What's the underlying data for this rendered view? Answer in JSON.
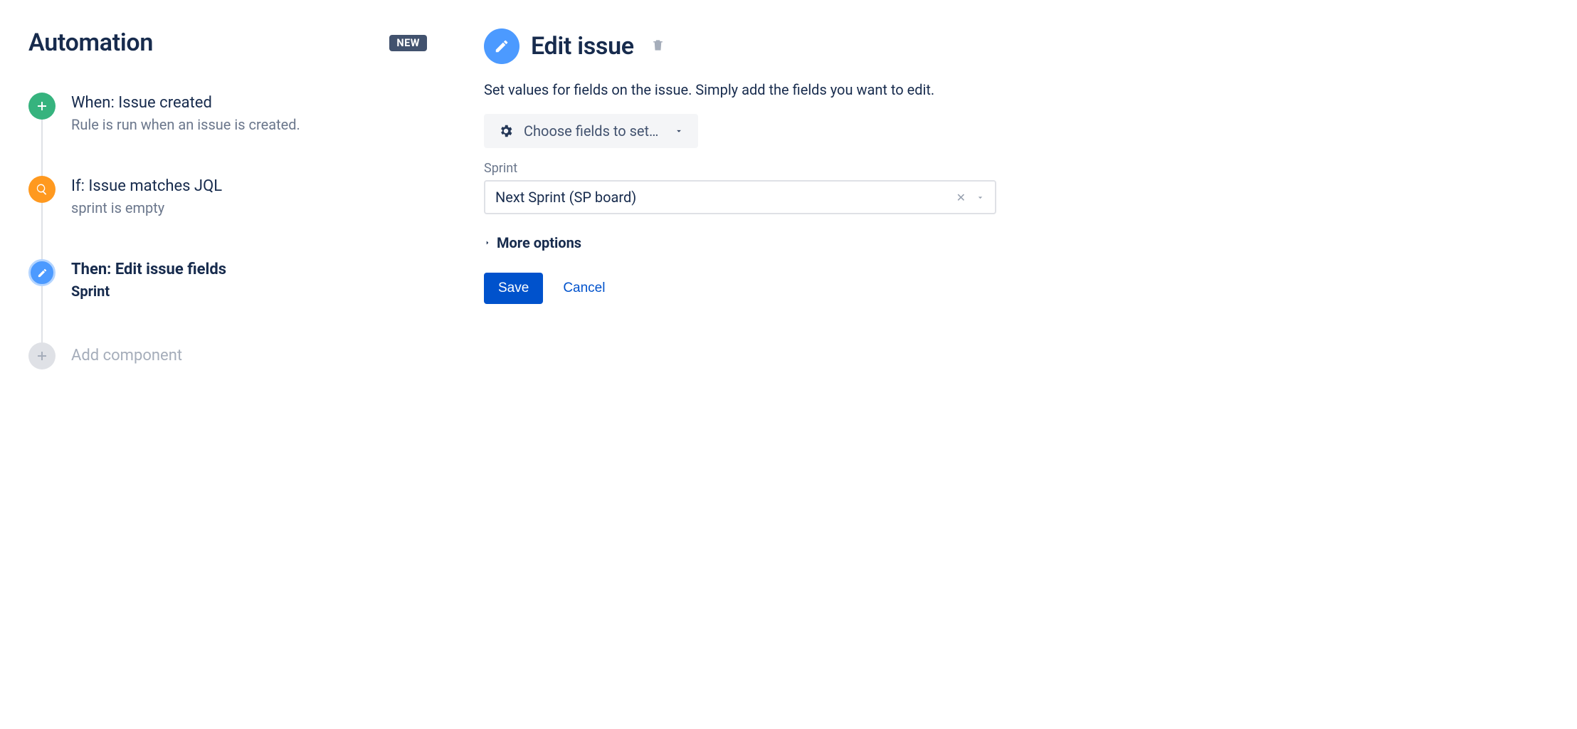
{
  "header": {
    "title": "Automation",
    "badge": "NEW"
  },
  "steps": {
    "trigger": {
      "title": "When: Issue created",
      "desc": "Rule is run when an issue is created."
    },
    "condition": {
      "title": "If: Issue matches JQL",
      "desc": "sprint is empty"
    },
    "action": {
      "title": "Then: Edit issue fields",
      "sub": "Sprint"
    },
    "add": "Add component"
  },
  "panel": {
    "title": "Edit issue",
    "desc": "Set values for fields on the issue. Simply add the fields you want to edit.",
    "chooser_label": "Choose fields to set…",
    "field_label": "Sprint",
    "field_value": "Next Sprint (SP board)",
    "more_options": "More options",
    "save": "Save",
    "cancel": "Cancel"
  }
}
